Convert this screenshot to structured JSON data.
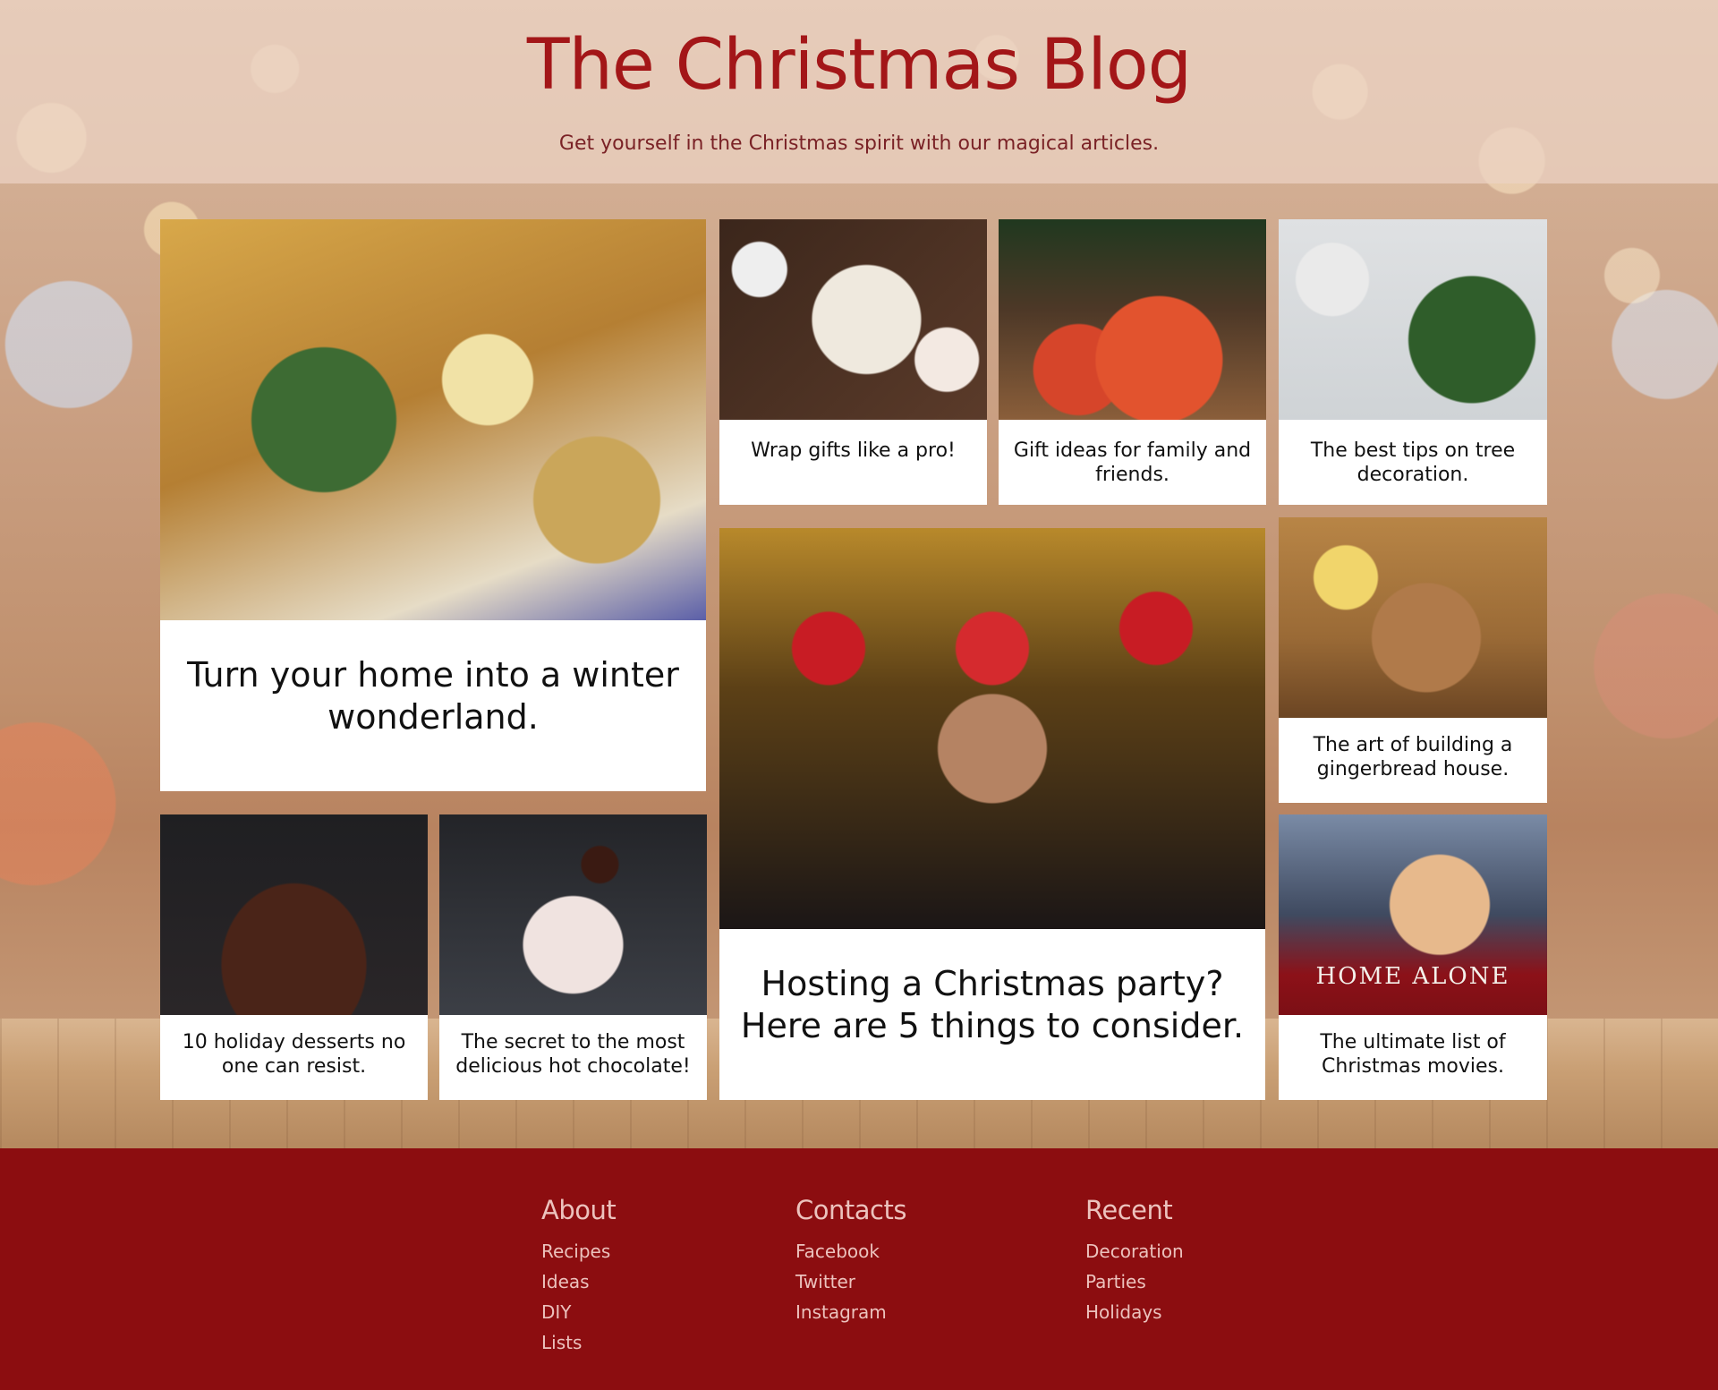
{
  "header": {
    "title": "The Christmas Blog",
    "subtitle": "Get yourself in the Christmas spirit with our magical articles."
  },
  "articles": [
    {
      "caption": "Turn your home into a winter wonderland.",
      "image": "living-room-decorated"
    },
    {
      "caption": "Wrap gifts like a pro!",
      "image": "wrapped-gift"
    },
    {
      "caption": "Gift ideas for family and friends.",
      "image": "presents-under-tree"
    },
    {
      "caption": "The best tips on tree decoration.",
      "image": "tree-ornament"
    },
    {
      "caption": "Hosting a Christmas party? Here are 5 things to consider.",
      "image": "christmas-party"
    },
    {
      "caption": "The art of building a gingerbread house.",
      "image": "gingerbread-house"
    },
    {
      "caption": "10 holiday desserts no one can resist.",
      "image": "chocolate-cake"
    },
    {
      "caption": "The secret to the most delicious hot chocolate!",
      "image": "hot-chocolate"
    },
    {
      "caption": "The ultimate list of Christmas movies.",
      "image": "home-alone-poster",
      "poster_text": "HOME ALONE"
    }
  ],
  "footer": {
    "about": {
      "heading": "About",
      "links": [
        "Recipes",
        "Ideas",
        "DIY",
        "Lists"
      ]
    },
    "contacts": {
      "heading": "Contacts",
      "links": [
        "Facebook",
        "Twitter",
        "Instagram"
      ]
    },
    "recent": {
      "heading": "Recent",
      "links": [
        "Decoration",
        "Parties",
        "Holidays"
      ]
    }
  },
  "colors": {
    "brand": "#a31618",
    "footer_bg": "#8c0d10",
    "footer_text": "#ecc2bd"
  }
}
